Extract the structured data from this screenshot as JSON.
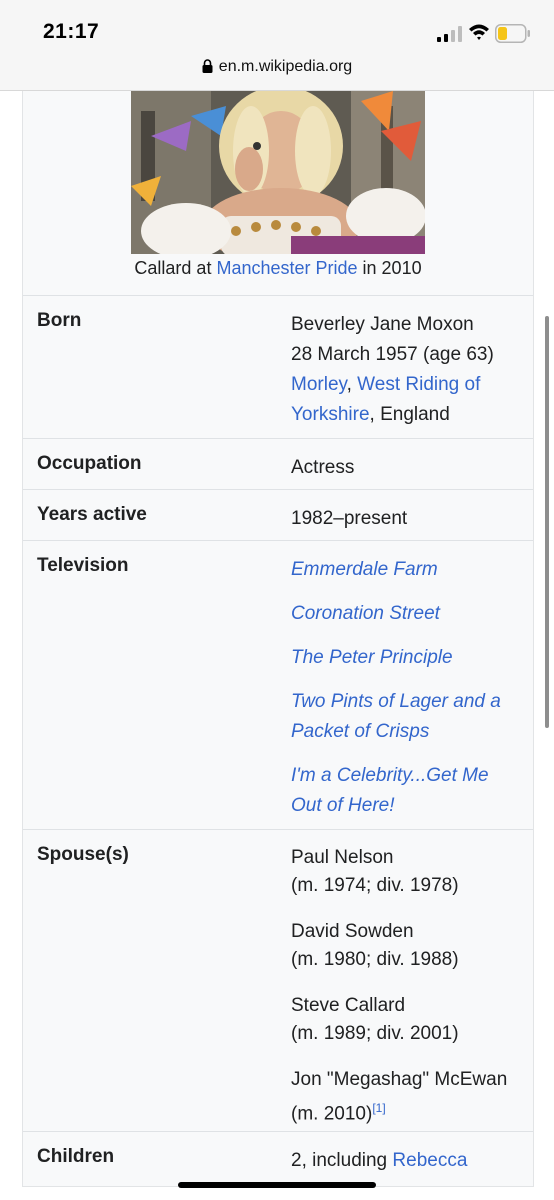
{
  "status": {
    "time": "21:17",
    "url": "en.m.wikipedia.org",
    "battery_color": "#f5c518"
  },
  "image": {
    "caption_prefix": "Callard at ",
    "caption_link": "Manchester Pride",
    "caption_suffix": " in 2010"
  },
  "rows": {
    "born": {
      "label": "Born",
      "line1": "Beverley Jane Moxon",
      "line2": "28 March 1957 (age 63)",
      "place_link1": "Morley",
      "sep": ", ",
      "place_link2a": "West Riding of",
      "place_link2b": "Yorkshire",
      "place_suffix": ", England"
    },
    "occupation": {
      "label": "Occupation",
      "value": "Actress"
    },
    "years_active": {
      "label": "Years active",
      "value": "1982–present"
    },
    "television": {
      "label": "Television",
      "items": [
        "Emmerdale Farm",
        "Coronation Street",
        "The Peter Principle",
        "Two Pints of Lager and a",
        "Packet of Crisps",
        "I'm a Celebrity...Get Me",
        "Out of Here!"
      ]
    },
    "spouses": {
      "label": "Spouse(s)",
      "items": [
        {
          "name": "Paul Nelson",
          "dates": "(m. 1974; div. 1978)"
        },
        {
          "name": "David Sowden",
          "dates": "(m. 1980; div. 1988)"
        },
        {
          "name": "Steve Callard",
          "dates": "(m. 1989; div. 2001)"
        },
        {
          "name": "Jon \"Megashag\" McEwan",
          "dates": "(m. 2010)",
          "ref": "[1]"
        }
      ]
    },
    "children": {
      "label": "Children",
      "prefix": "2, including ",
      "link": "Rebecca"
    }
  },
  "colors": {
    "link": "#3366cc",
    "infobox_bg": "#f8f9fa",
    "text": "#202122"
  }
}
